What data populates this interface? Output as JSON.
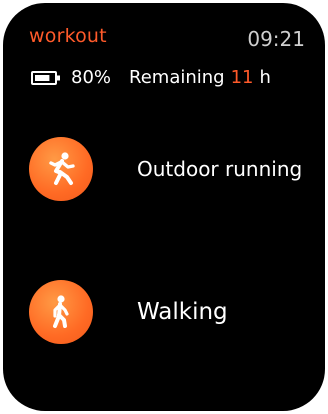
{
  "header": {
    "app_title": "workout",
    "time": "09:21"
  },
  "status": {
    "battery_percent": "80%",
    "remaining_label": "Remaining",
    "remaining_value": "11",
    "remaining_unit": "h",
    "battery_level": 0.8
  },
  "activities": [
    {
      "label": "Outdoor running",
      "icon": "running-person-icon"
    },
    {
      "label": "Walking",
      "icon": "walking-person-icon"
    }
  ],
  "colors": {
    "accent": "#ff5a2a",
    "background": "#000000",
    "text": "#ffffff",
    "clock": "#cfcfcf"
  }
}
